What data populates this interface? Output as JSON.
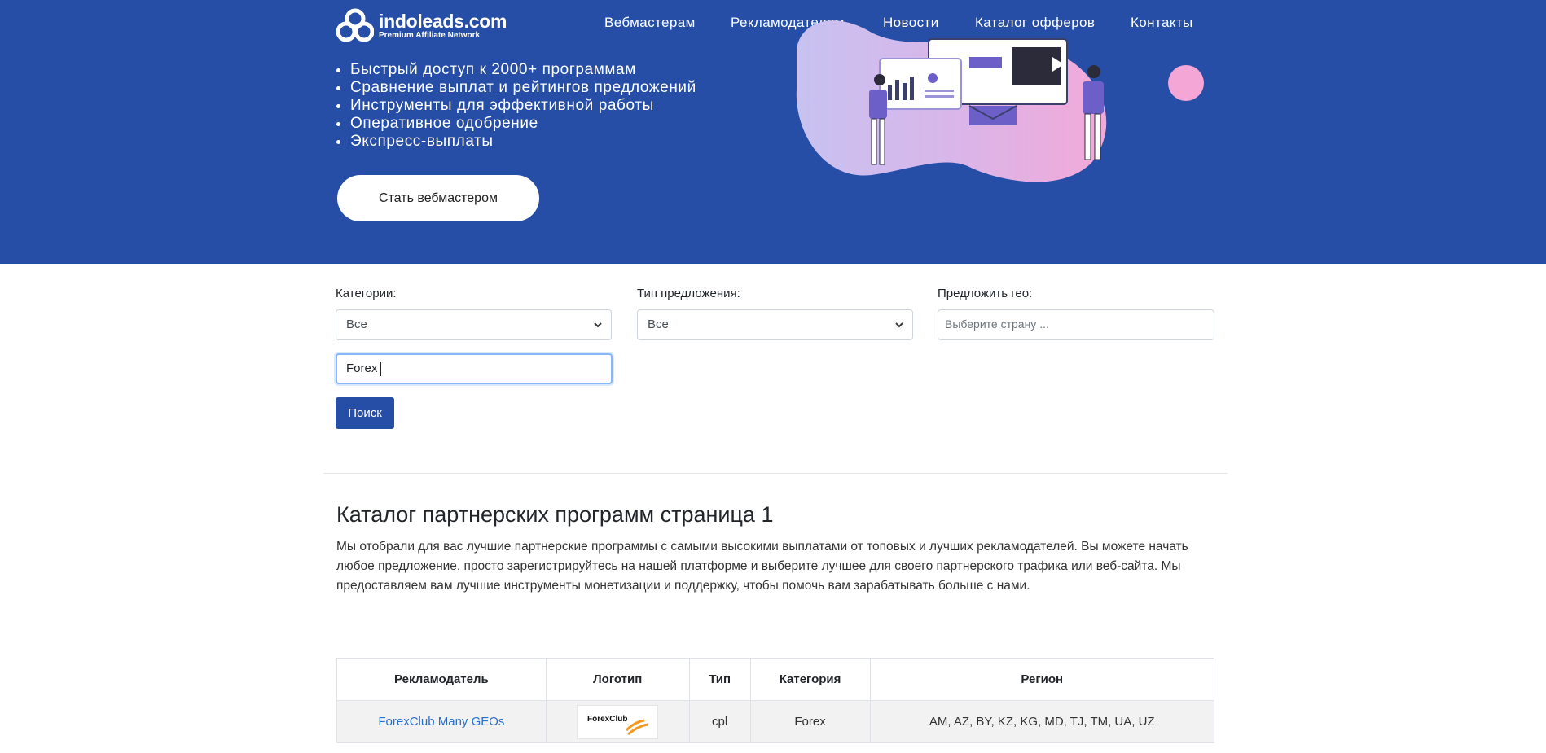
{
  "header": {
    "logo_name": "indoleads.com",
    "logo_tagline": "Premium Affiliate Network",
    "nav": [
      "Вебмастерам",
      "Рекламодателям",
      "Новости",
      "Каталог офферов",
      "Контакты"
    ]
  },
  "hero": {
    "features": [
      "Быстрый доступ к 2000+ программам",
      "Сравнение выплат и рейтингов предложений",
      "Инструменты для эффективной работы",
      "Оперативное одобрение",
      "Экспресс-выплаты"
    ],
    "cta_label": "Стать вебмастером"
  },
  "filters": {
    "category_label": "Категории:",
    "category_value": "Все",
    "type_label": "Тип предложения:",
    "type_value": "Все",
    "geo_label": "Предложить гео:",
    "geo_placeholder": "Выберите страну ...",
    "search_value": "Forex",
    "search_button": "Поиск"
  },
  "catalog": {
    "title": "Каталог партнерских программ страница 1",
    "description": "Мы отобрали для вас лучшие партнерские программы с самыми высокими выплатами от топовых и лучших рекламодателей. Вы можете начать любое предложение, просто зарегистрируйтесь на нашей платформе и выберите лучшее для своего партнерского трафика или веб-сайта. Мы предоставляем вам лучшие инструменты монетизации и поддержку, чтобы помочь вам зарабатывать больше с нами."
  },
  "table": {
    "headers": [
      "Рекламодатель",
      "Логотип",
      "Тип",
      "Категория",
      "Регион"
    ],
    "rows": [
      {
        "advertiser": "ForexClub Many GEOs",
        "logo_text": "ForexClub",
        "type": "cpl",
        "category": "Forex",
        "region": "AM, AZ, BY, KZ, KG, MD, TJ, TM, UA, UZ"
      }
    ]
  },
  "colors": {
    "brand_blue": "#264ea6",
    "link": "#2a6fc9",
    "illustration_pink": "#f4a6d7",
    "illustration_purple": "#6c5fc7"
  },
  "icons": [
    "logo-mark-icon",
    "chevron-down-icon"
  ]
}
